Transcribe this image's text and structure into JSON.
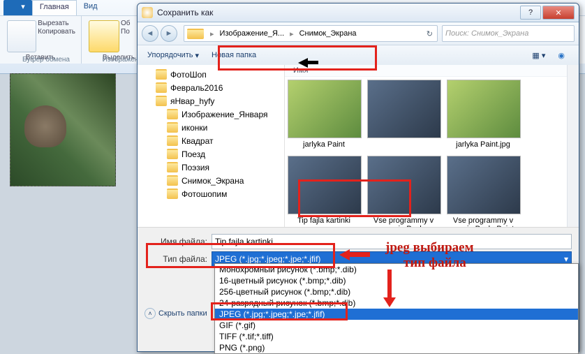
{
  "ribbon": {
    "tab_file": "",
    "tab_home": "Главная",
    "tab_view": "Вид",
    "cut": "Вырезать",
    "copy": "Копировать",
    "paste_label": "Вставить",
    "group_clipboard": "Буфер обмена",
    "select_label": "Выделить",
    "group_image": "Изображение",
    "crop": "Об",
    "resize": "По"
  },
  "dialog": {
    "title": "Сохранить как",
    "breadcrumb": {
      "root_icon": "folder",
      "p1": "Изображение_Я...",
      "p2": "Снимок_Экрана"
    },
    "search_placeholder": "Поиск: Снимок_Экрана",
    "organize": "Упорядочить",
    "new_folder": "Новая папка",
    "hide_folders": "Скрыть папки",
    "tree": [
      {
        "label": "ФотоШоп",
        "indent": 1
      },
      {
        "label": "Февраль2016",
        "indent": 1
      },
      {
        "label": "яНвар_hyfy",
        "indent": 1
      },
      {
        "label": "Изображение_Января",
        "indent": 2
      },
      {
        "label": "иконки",
        "indent": 2
      },
      {
        "label": "Квадрат",
        "indent": 2
      },
      {
        "label": "Поезд",
        "indent": 2
      },
      {
        "label": "Поэзия",
        "indent": 2
      },
      {
        "label": "Снимок_Экрана",
        "indent": 2,
        "selected": true
      },
      {
        "label": "Фотошопим",
        "indent": 2
      }
    ],
    "content_col": "Имя",
    "thumbs": [
      {
        "name": "jarlyka Paint",
        "cls": "paint"
      },
      {
        "name": "",
        "cls": ""
      },
      {
        "name": "jarlyka Paint.jpg",
        "cls": "paint"
      },
      {
        "name": "Tip fajla kartinki",
        "cls": ""
      },
      {
        "name": "Vse programmy v menju Pusk",
        "cls": ""
      },
      {
        "name": "Vse programmy v menju Pusk_Paint",
        "cls": ""
      }
    ],
    "filename_label": "Имя файла:",
    "filename_value": "Tip fajla kartinki",
    "filetype_label": "Тип файла:",
    "filetype_value": "JPEG (*.jpg;*.jpeg;*.jpe;*.jfif)",
    "format_options": [
      "Монохромный рисунок (*.bmp;*.dib)",
      "16-цветный рисунок (*.bmp;*.dib)",
      "256-цветный рисунок (*.bmp;*.dib)",
      "24-разрядный рисунок (*.bmp;*.dib)",
      "JPEG (*.jpg;*.jpeg;*.jpe;*.jfif)",
      "GIF (*.gif)",
      "TIFF (*.tif;*.tiff)",
      "PNG (*.png)"
    ],
    "selected_option_index": 4
  },
  "annotations": {
    "line1": "jpeg выбираем",
    "line2": "тип файла"
  }
}
